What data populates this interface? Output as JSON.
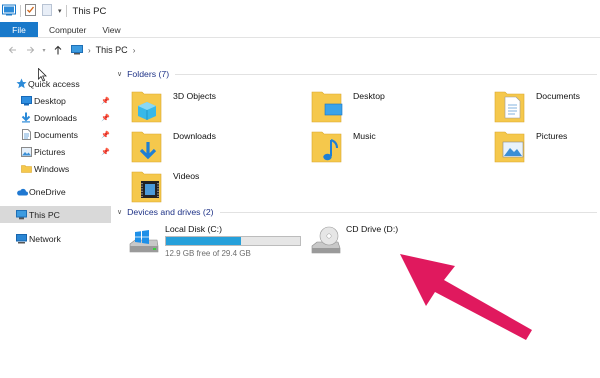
{
  "window": {
    "title": "This PC"
  },
  "ribbon": {
    "tabs": [
      "File",
      "Computer",
      "View"
    ]
  },
  "address": {
    "path": [
      "This PC"
    ]
  },
  "sidebar": {
    "quick_access": "Quick access",
    "pinned": [
      {
        "label": "Desktop",
        "icon": "desktop-icon"
      },
      {
        "label": "Downloads",
        "icon": "downloads-icon"
      },
      {
        "label": "Documents",
        "icon": "documents-icon"
      },
      {
        "label": "Pictures",
        "icon": "pictures-icon"
      },
      {
        "label": "Windows",
        "icon": "folder-icon"
      }
    ],
    "onedrive": "OneDrive",
    "this_pc": "This PC",
    "network": "Network"
  },
  "folders": {
    "header": "Folders (7)",
    "items": [
      "3D Objects",
      "Desktop",
      "Documents",
      "Downloads",
      "Music",
      "Pictures",
      "Videos"
    ]
  },
  "drives": {
    "header": "Devices and drives (2)",
    "items": [
      {
        "name": "Local Disk (C:)",
        "free_text": "12.9 GB free of 29.4 GB",
        "used_fraction": 0.56
      },
      {
        "name": "CD Drive (D:)"
      }
    ]
  },
  "colors": {
    "accent": "#1979ca",
    "annotation_arrow": "#e0195e",
    "selection": "#d9d9d9",
    "folder": "#f5c84c"
  }
}
